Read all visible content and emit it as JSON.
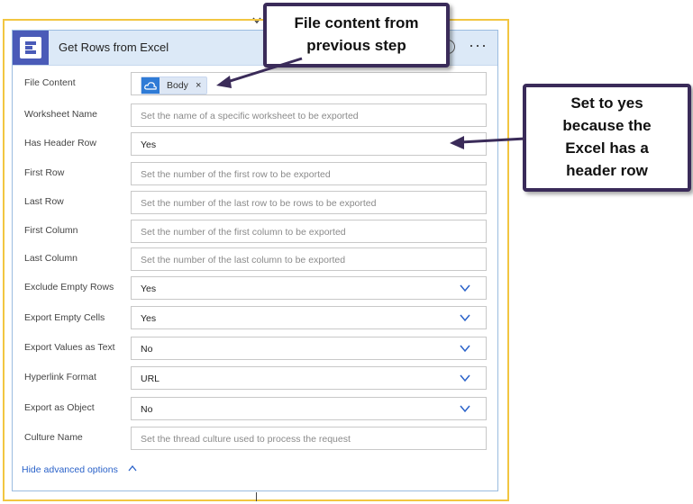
{
  "card": {
    "title": "Get Rows from Excel",
    "menu_label": "···",
    "app_icon": "excel-e-icon"
  },
  "fields": [
    {
      "label": "File Content",
      "token": "Body",
      "token_close": "×"
    },
    {
      "label": "Worksheet Name",
      "placeholder": "Set the name of a specific worksheet to be exported"
    },
    {
      "label": "Has Header Row",
      "value": "Yes"
    },
    {
      "label": "First Row",
      "placeholder": "Set the number of the first row to be exported"
    },
    {
      "label": "Last Row",
      "placeholder": "Set the number of the last row to be rows to be exported"
    },
    {
      "label": "First Column",
      "placeholder": "Set the number of the first column to be exported"
    },
    {
      "label": "Last Column",
      "placeholder": "Set the number of the last column to be exported"
    },
    {
      "label": "Exclude Empty Rows",
      "value": "Yes"
    },
    {
      "label": "Export Empty Cells",
      "value": "Yes"
    },
    {
      "label": "Export Values as Text",
      "value": "No"
    },
    {
      "label": "Hyperlink Format",
      "value": "URL"
    },
    {
      "label": "Export as Object",
      "value": "No"
    },
    {
      "label": "Culture Name",
      "placeholder": "Set the thread culture used to process the request"
    }
  ],
  "advanced_toggle": "Hide advanced options",
  "callouts": {
    "file_content": {
      "line1": "File content from",
      "line2": "previous step"
    },
    "header_row": {
      "line1": "Set to yes",
      "line2": "because the",
      "line3": "Excel has a",
      "line4": "header row"
    }
  },
  "colors": {
    "accent_border": "#f2c641",
    "header_bg": "#dce9f7",
    "callout_border": "#3a2b59",
    "link": "#2a62c9"
  }
}
